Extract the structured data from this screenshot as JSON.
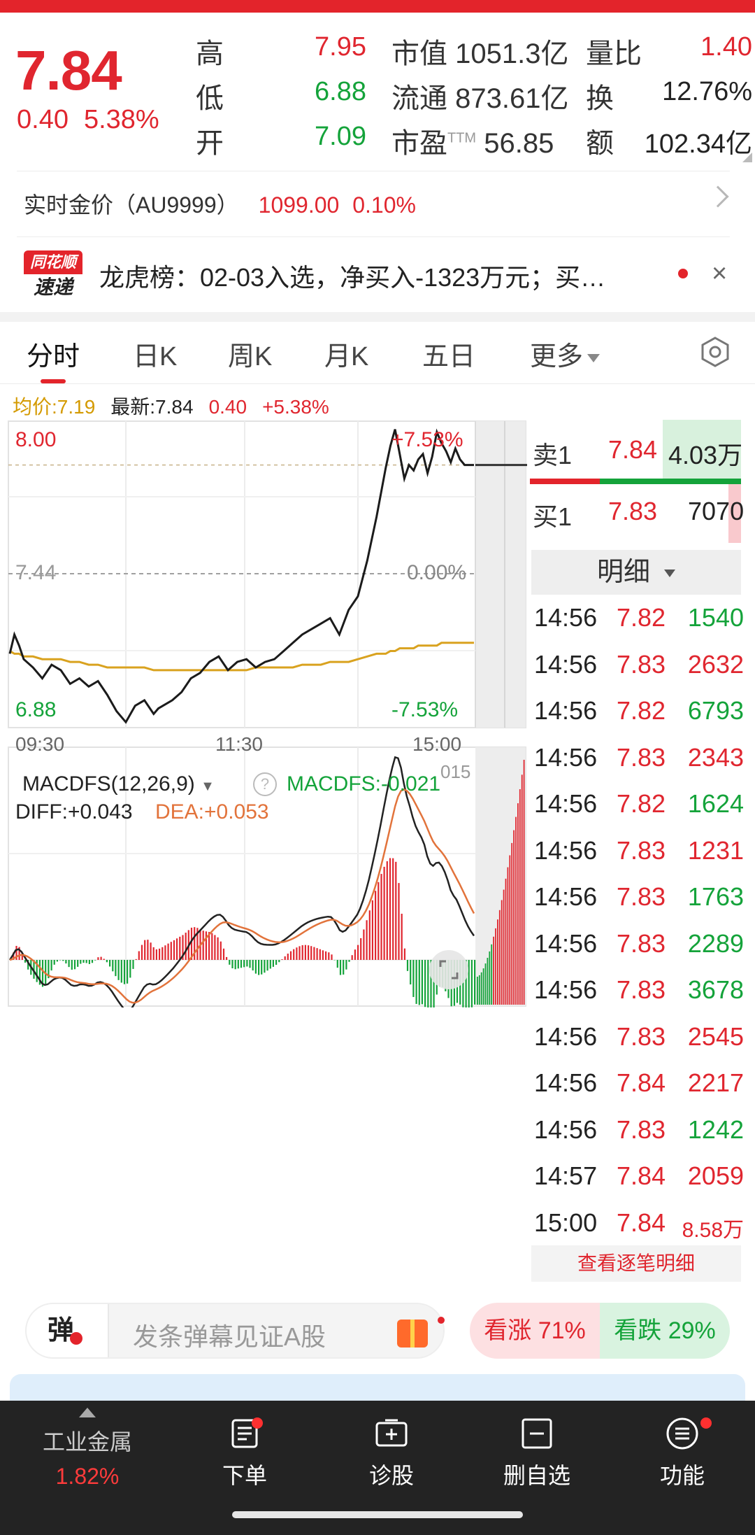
{
  "quote": {
    "price": "7.84",
    "change": "0.40",
    "change_pct": "5.38%",
    "high_label": "高",
    "high": "7.95",
    "low_label": "低",
    "low": "6.88",
    "open_label": "开",
    "open": "7.09",
    "mcap_label": "市值",
    "mcap": "1051.3亿",
    "float_label": "流通",
    "float": "873.61亿",
    "pe_label": "市盈",
    "pe_sup": "TTM",
    "pe": "56.85",
    "vr_label": "量比",
    "vr": "1.40",
    "turnover_label": "换",
    "turnover": "12.76%",
    "amount_label": "额",
    "amount": "102.34亿"
  },
  "gold": {
    "label": "实时金价（AU9999）",
    "price": "1099.00",
    "pct": "0.10%"
  },
  "news": {
    "logo_top": "同花顺",
    "logo_bottom": "速递",
    "text": "龙虎榜：02-03入选，净买入-1323万元；买…",
    "close": "×"
  },
  "tabs": [
    "分时",
    "日K",
    "周K",
    "月K",
    "五日",
    "更多"
  ],
  "info": {
    "avg": "均价:7.19",
    "latest": "最新:7.84",
    "change": "0.40",
    "pct": "+5.38%"
  },
  "chart_data": {
    "type": "line",
    "title": "",
    "y_max_label": "8.00",
    "y_mid_label": "7.44",
    "y_min_label": "6.88",
    "pct_max_label": "+7.53%",
    "pct_mid_label": "0.00%",
    "pct_min_label": "-7.53%",
    "x_labels": [
      "09:30",
      "11:30",
      "15:00"
    ],
    "ylim": [
      6.88,
      8.0
    ],
    "prev_close": 7.44,
    "x": [
      0,
      0.01,
      0.02,
      0.03,
      0.05,
      0.07,
      0.09,
      0.11,
      0.13,
      0.15,
      0.17,
      0.19,
      0.21,
      0.23,
      0.25,
      0.27,
      0.29,
      0.31,
      0.32,
      0.33,
      0.35,
      0.37,
      0.39,
      0.41,
      0.43,
      0.45,
      0.47,
      0.49,
      0.51,
      0.53,
      0.55,
      0.57,
      0.59,
      0.61,
      0.63,
      0.65,
      0.67,
      0.69,
      0.71,
      0.73,
      0.75,
      0.77,
      0.79,
      0.81,
      0.82,
      0.83,
      0.84,
      0.85,
      0.86,
      0.87,
      0.88,
      0.89,
      0.9,
      0.91,
      0.92,
      0.93,
      0.94,
      0.95,
      0.96,
      0.97,
      0.98,
      1.0
    ],
    "price": [
      7.15,
      7.22,
      7.18,
      7.13,
      7.1,
      7.06,
      7.11,
      7.09,
      7.04,
      7.06,
      7.03,
      7.05,
      7.0,
      6.94,
      6.9,
      6.96,
      6.98,
      6.93,
      6.95,
      6.96,
      6.98,
      7.01,
      7.06,
      7.08,
      7.12,
      7.14,
      7.09,
      7.12,
      7.13,
      7.1,
      7.12,
      7.13,
      7.16,
      7.19,
      7.22,
      7.24,
      7.26,
      7.28,
      7.22,
      7.31,
      7.36,
      7.49,
      7.65,
      7.83,
      7.91,
      7.97,
      7.88,
      7.79,
      7.84,
      7.82,
      7.86,
      7.88,
      7.81,
      7.87,
      7.96,
      7.92,
      7.89,
      7.85,
      7.9,
      7.86,
      7.84,
      7.84
    ],
    "avg": [
      7.16,
      7.15,
      7.15,
      7.14,
      7.14,
      7.13,
      7.13,
      7.13,
      7.12,
      7.12,
      7.11,
      7.11,
      7.1,
      7.1,
      7.1,
      7.1,
      7.1,
      7.09,
      7.09,
      7.09,
      7.09,
      7.09,
      7.09,
      7.09,
      7.09,
      7.09,
      7.09,
      7.09,
      7.09,
      7.1,
      7.1,
      7.1,
      7.1,
      7.1,
      7.11,
      7.11,
      7.11,
      7.12,
      7.12,
      7.12,
      7.13,
      7.14,
      7.15,
      7.15,
      7.16,
      7.16,
      7.17,
      7.17,
      7.17,
      7.17,
      7.18,
      7.18,
      7.18,
      7.18,
      7.18,
      7.19,
      7.19,
      7.19,
      7.19,
      7.19,
      7.19,
      7.19
    ],
    "macd": {
      "label": "MACDFS(12,26,9)",
      "value_label": "MACDFS:-0.021",
      "diff": "DIFF:+0.043",
      "dea": "DEA:+0.053",
      "extra": "015"
    }
  },
  "orderbook": {
    "ask_label": "卖1",
    "ask_price": "7.84",
    "ask_vol": "4.03万",
    "bid_label": "买1",
    "bid_price": "7.83",
    "bid_vol": "7070",
    "detail_label": "明细",
    "ticks": [
      {
        "time": "14:56",
        "price": "7.82",
        "vol": "1540",
        "side": "down"
      },
      {
        "time": "14:56",
        "price": "7.83",
        "vol": "2632",
        "side": "up"
      },
      {
        "time": "14:56",
        "price": "7.82",
        "vol": "6793",
        "side": "down"
      },
      {
        "time": "14:56",
        "price": "7.83",
        "vol": "2343",
        "side": "up"
      },
      {
        "time": "14:56",
        "price": "7.82",
        "vol": "1624",
        "side": "down"
      },
      {
        "time": "14:56",
        "price": "7.83",
        "vol": "1231",
        "side": "up"
      },
      {
        "time": "14:56",
        "price": "7.83",
        "vol": "1763",
        "side": "down"
      },
      {
        "time": "14:56",
        "price": "7.83",
        "vol": "2289",
        "side": "down"
      },
      {
        "time": "14:56",
        "price": "7.83",
        "vol": "3678",
        "side": "down"
      },
      {
        "time": "14:56",
        "price": "7.83",
        "vol": "2545",
        "side": "up"
      },
      {
        "time": "14:56",
        "price": "7.84",
        "vol": "2217",
        "side": "up"
      },
      {
        "time": "14:56",
        "price": "7.83",
        "vol": "1242",
        "side": "down"
      },
      {
        "time": "14:57",
        "price": "7.84",
        "vol": "2059",
        "side": "up"
      },
      {
        "time": "15:00",
        "price": "7.84",
        "vol": "8.58万",
        "side": "up"
      }
    ],
    "link": "查看逐笔明细"
  },
  "danmu": {
    "btn": "弹",
    "placeholder": "发条弹幕见证A股"
  },
  "vote": {
    "up": "看涨 71%",
    "down": "看跌 29%"
  },
  "nav": {
    "sector": "工业金属",
    "sector_pct": "1.82%",
    "items": [
      "下单",
      "诊股",
      "删自选",
      "功能"
    ]
  },
  "colors": {
    "up": "#e0262f",
    "down": "#14a33a",
    "avg_line": "#d49a00",
    "accent": "#e3242b"
  }
}
